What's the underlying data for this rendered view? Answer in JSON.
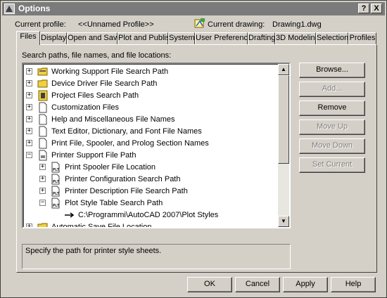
{
  "window": {
    "title": "Options",
    "help_label": "?",
    "close_label": "X"
  },
  "header": {
    "current_profile_label": "Current profile:",
    "current_profile_value": "<<Unnamed Profile>>",
    "current_drawing_label": "Current drawing:",
    "current_drawing_value": "Drawing1.dwg"
  },
  "tabs": [
    {
      "label": "Files",
      "active": true
    },
    {
      "label": "Display"
    },
    {
      "label": "Open and Save"
    },
    {
      "label": "Plot and Publish"
    },
    {
      "label": "System"
    },
    {
      "label": "User Preferences"
    },
    {
      "label": "Drafting"
    },
    {
      "label": "3D Modeling"
    },
    {
      "label": "Selection"
    },
    {
      "label": "Profiles"
    }
  ],
  "files": {
    "search_label": "Search paths, file names, and file locations:",
    "tree": [
      {
        "label": "Working Support File Search Path",
        "icon": "folder-icon",
        "expander": "+"
      },
      {
        "label": "Device Driver File Search Path",
        "icon": "folder-icon",
        "expander": "+"
      },
      {
        "label": "Project Files Search Path",
        "icon": "project-icon",
        "expander": "+"
      },
      {
        "label": "Customization Files",
        "icon": "file-icon",
        "expander": "+"
      },
      {
        "label": "Help and Miscellaneous File Names",
        "icon": "file-icon",
        "expander": "+"
      },
      {
        "label": "Text Editor, Dictionary, and Font File Names",
        "icon": "file-icon",
        "expander": "+"
      },
      {
        "label": "Print File, Spooler, and Prolog Section Names",
        "icon": "file-icon",
        "expander": "+"
      },
      {
        "label": "Printer Support File Path",
        "icon": "printer-folder-icon",
        "expander": "-"
      },
      {
        "label": "Print Spooler File Location",
        "icon": "plt-icon",
        "expander": "+"
      },
      {
        "label": "Printer Configuration Search Path",
        "icon": "plt-icon",
        "expander": "+"
      },
      {
        "label": "Printer Description File Search Path",
        "icon": "plt-icon",
        "expander": "+"
      },
      {
        "label": "Plot Style Table Search Path",
        "icon": "plt-icon",
        "expander": "-"
      },
      {
        "label": "C:\\Programmi\\AutoCAD 2007\\Plot Styles",
        "icon": "arrow-icon"
      },
      {
        "label": "Automatic Save File Location",
        "icon": "folder-icon",
        "expander": "+"
      }
    ],
    "buttons": {
      "browse": "Browse...",
      "add": "Add...",
      "remove": "Remove",
      "move_up": "Move Up",
      "move_down": "Move Down",
      "set_current": "Set Current"
    },
    "description": "Specify the path for printer style sheets."
  },
  "footer": {
    "ok": "OK",
    "cancel": "Cancel",
    "apply": "Apply",
    "help": "Help"
  }
}
